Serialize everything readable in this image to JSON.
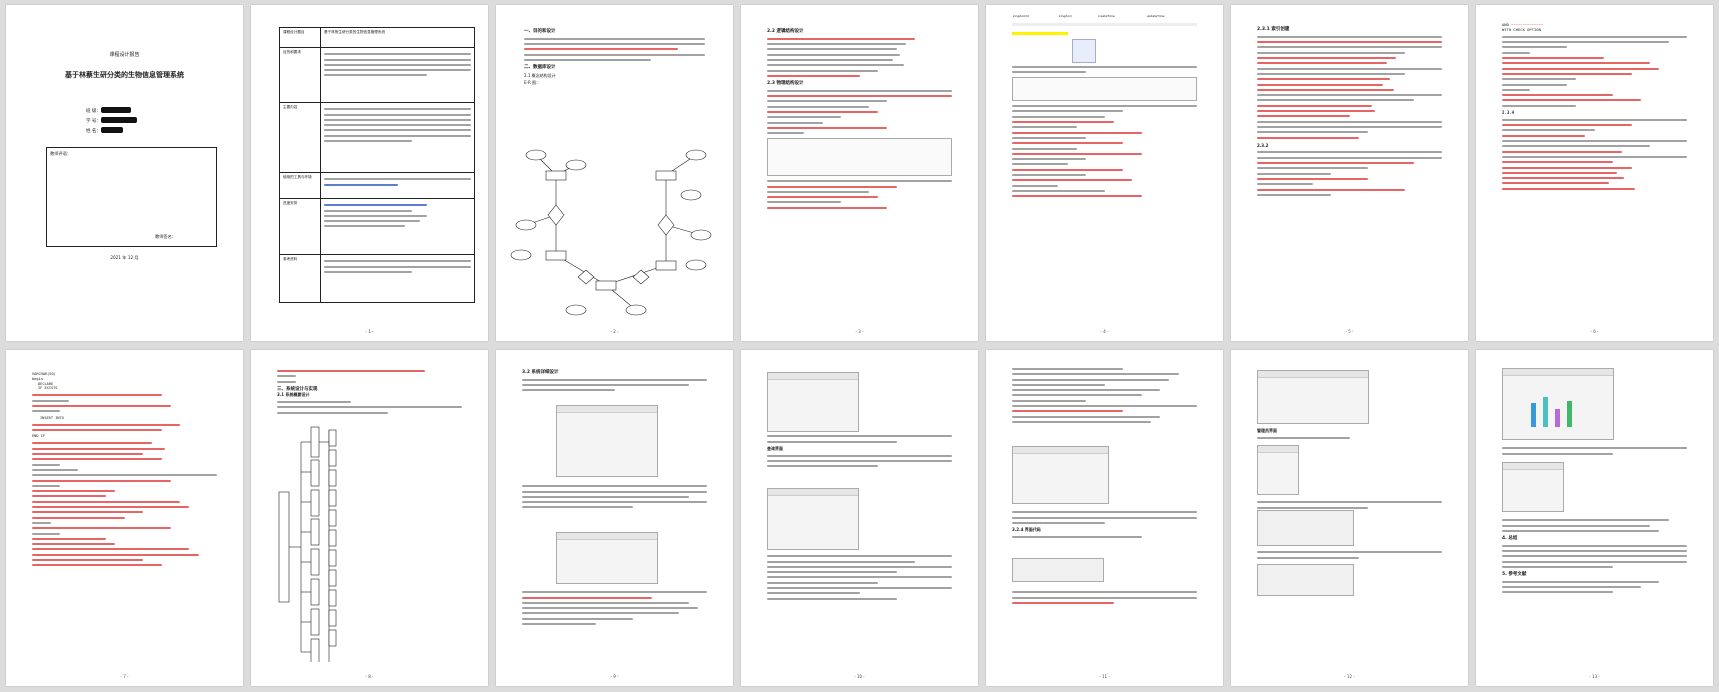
{
  "document": {
    "pages_row1": [
      "1",
      "2",
      "3",
      "4",
      "5",
      "6",
      "7"
    ],
    "cover": {
      "header": "课程设计报告",
      "title": "基于林蔡生研分类的生物信息管理系统",
      "field_labels": [
        "班  级：",
        "学  号：",
        "姓  名："
      ],
      "teacher_comment": "教师评语：",
      "teacher_sign": "教师签名：",
      "date": "2021 年 12 月"
    },
    "page2": {
      "rows": [
        {
          "label": "课程设计题目",
          "value": "基于林蔡生研分类的生物信息管理系统"
        },
        {
          "label": "目的和要求",
          "value": ""
        },
        {
          "label": "主要内容",
          "value": ""
        },
        {
          "label": "使用的工具与环境",
          "value": "Microsoft SQL Server 2019 Navicat"
        },
        {
          "label": "进度安排",
          "value": ""
        },
        {
          "label": "参考资料",
          "value": ""
        }
      ]
    },
    "page3": {
      "h1": "一、目的和设计",
      "h2": "二、数据库设计",
      "h3": "2.1 概念结构设计",
      "h4": "E-R 图："
    },
    "page4": {
      "h1": "2.2 逻辑结构设计",
      "h2": "2.3 物理结构设计"
    },
    "page5": {
      "table_cols": [
        "kingdomId",
        "kingdom",
        "createTime",
        "updateTime"
      ]
    },
    "page6": {
      "h1": "2.3.1 索引创建"
    },
    "page7": {
      "cmd": "AND",
      "check": "WITH CHECK OPTION"
    },
    "row2": {
      "p8_code": [
        "VARCHAR(50)",
        "begin",
        "DECLARE",
        "IF EXISTS",
        "INSERT INTO",
        "END IF"
      ],
      "p9_h1": "三、系统设计与实现",
      "p9_h2": "3.1 系统概要设计",
      "p10_h1": "3.2 系统详细设计",
      "p11_h1": "查询界面",
      "p12_h1": "3.2.4 界面代码",
      "p13_h1": "管理员界面",
      "p14_h1": "4. 总结",
      "p14_h2": "5. 参考文献"
    }
  }
}
